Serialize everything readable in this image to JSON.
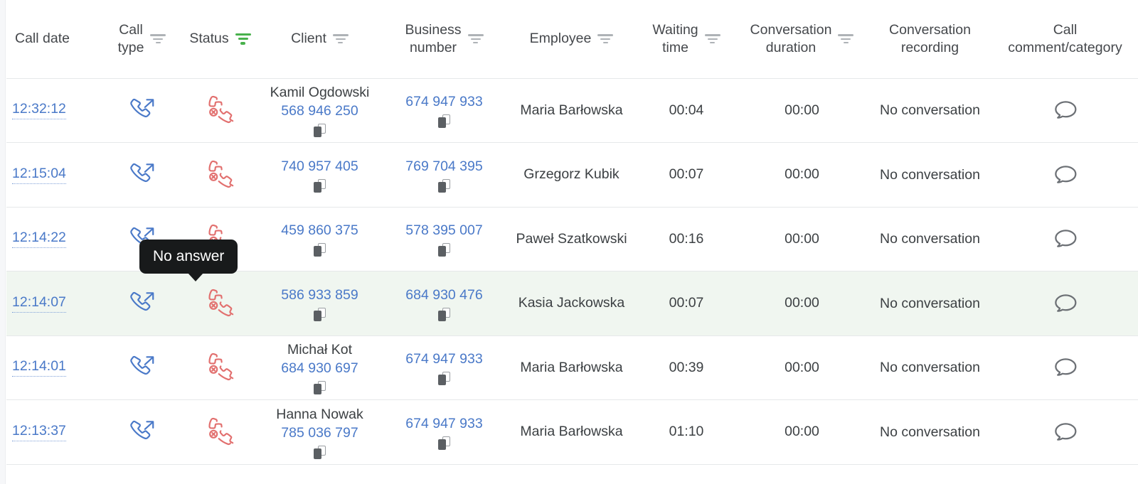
{
  "table": {
    "columns": [
      {
        "label": "Call date",
        "filter": "none"
      },
      {
        "label": "Call\ntype",
        "filter": "gray"
      },
      {
        "label": "Status",
        "filter": "green"
      },
      {
        "label": "Client",
        "filter": "gray"
      },
      {
        "label": "Business\nnumber",
        "filter": "gray"
      },
      {
        "label": "Employee",
        "filter": "gray"
      },
      {
        "label": "Waiting\ntime",
        "filter": "gray"
      },
      {
        "label": "Conversation\nduration",
        "filter": "gray"
      },
      {
        "label": "Conversation\nrecording",
        "filter": "none"
      },
      {
        "label": "Call\ncomment/category",
        "filter": "none"
      }
    ],
    "rows": [
      {
        "call_date": "12:32:12",
        "call_type_icon": "outgoing-call-icon",
        "status_icon": "no-answer-icon",
        "client_name": "Kamil Ogdowski",
        "client_number": "568 946 250",
        "business_number": "674 947 933",
        "employee": "Maria Barłowska",
        "waiting_time": "00:04",
        "conversation_duration": "00:00",
        "conversation_recording": "No conversation",
        "comment_icon": "speech-bubble-icon",
        "highlighted": false
      },
      {
        "call_date": "12:15:04",
        "call_type_icon": "outgoing-call-icon",
        "status_icon": "no-answer-icon",
        "client_name": "",
        "client_number": "740 957 405",
        "business_number": "769 704 395",
        "employee": "Grzegorz Kubik",
        "waiting_time": "00:07",
        "conversation_duration": "00:00",
        "conversation_recording": "No conversation",
        "comment_icon": "speech-bubble-icon",
        "highlighted": false
      },
      {
        "call_date": "12:14:22",
        "call_type_icon": "outgoing-call-icon",
        "status_icon": "no-answer-icon",
        "client_name": "",
        "client_number": "459 860 375",
        "business_number": "578 395 007",
        "employee": "Paweł Szatkowski",
        "waiting_time": "00:16",
        "conversation_duration": "00:00",
        "conversation_recording": "No conversation",
        "comment_icon": "speech-bubble-icon",
        "highlighted": false
      },
      {
        "call_date": "12:14:07",
        "call_type_icon": "outgoing-call-icon",
        "status_icon": "no-answer-icon",
        "client_name": "",
        "client_number": "586 933 859",
        "business_number": "684 930 476",
        "employee": "Kasia Jackowska",
        "waiting_time": "00:07",
        "conversation_duration": "00:00",
        "conversation_recording": "No conversation",
        "comment_icon": "speech-bubble-icon",
        "highlighted": true
      },
      {
        "call_date": "12:14:01",
        "call_type_icon": "outgoing-call-icon",
        "status_icon": "no-answer-icon",
        "client_name": "Michał Kot",
        "client_number": "684 930 697",
        "business_number": "674 947 933",
        "employee": "Maria Barłowska",
        "waiting_time": "00:39",
        "conversation_duration": "00:00",
        "conversation_recording": "No conversation",
        "comment_icon": "speech-bubble-icon",
        "highlighted": false
      },
      {
        "call_date": "12:13:37",
        "call_type_icon": "outgoing-call-icon",
        "status_icon": "no-answer-icon",
        "client_name": "Hanna Nowak",
        "client_number": "785 036 797",
        "business_number": "674 947 933",
        "employee": "Maria Barłowska",
        "waiting_time": "01:10",
        "conversation_duration": "00:00",
        "conversation_recording": "No conversation",
        "comment_icon": "speech-bubble-icon",
        "highlighted": false
      }
    ]
  },
  "tooltip": {
    "text": "No answer"
  },
  "colors": {
    "link_blue": "#4a79c8",
    "status_red": "#e2706f",
    "filter_active_green": "#48b14c",
    "row_highlight": "#f0f6f0",
    "text": "#3c4043"
  }
}
